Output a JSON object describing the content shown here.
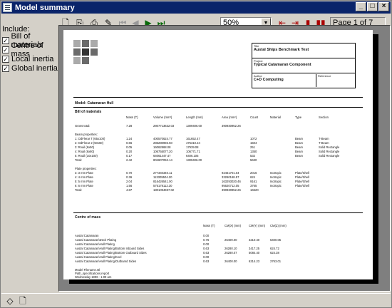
{
  "window": {
    "title": "Model summary"
  },
  "toolbar": {
    "zoom_value": "50%",
    "page_indicator": "Page 1 of 7",
    "icons": [
      "new-page-icon",
      "copy-icon",
      "print-icon",
      "print-setup-icon",
      "first-page-icon",
      "previous-page-icon",
      "next-page-icon",
      "last-page-icon",
      "fit-width-icon",
      "fit-page-icon",
      "one-page-icon",
      "two-page-icon"
    ]
  },
  "sidebar": {
    "include_label": "Include:",
    "options": [
      {
        "label": "Bill of materials",
        "checked": true
      },
      {
        "label": "Centre of mass",
        "checked": true
      },
      {
        "label": "Local inertia",
        "checked": true
      },
      {
        "label": "Global inertia",
        "checked": true
      }
    ]
  },
  "report": {
    "header": {
      "title_label": "Title",
      "title": "Austal Ships Benchmark Test",
      "project_label": "Project",
      "project": "Typical Catamaran Component",
      "author_label": "Author",
      "author": "C+D Computing",
      "reference_label": "Reference"
    },
    "model_line": "Model: Catamaran Hull",
    "bom_heading": "Bill of materials",
    "bom_columns": [
      "Mass (T)",
      "Volume (mm³)",
      "Length (mm)",
      "Area (mm²)",
      "Count",
      "Material",
      "Type",
      "Section"
    ],
    "bom_gross": [
      "Gross total:",
      "7.28",
      "2807713632.03",
      "1309406.00",
      "390930952.26",
      "",
      "",
      "",
      ""
    ],
    "beam_label": "Beam properties:",
    "beam_rows": [
      [
        "1: OdFlerar T (65x100)",
        "1.24",
        "400570624.77",
        "161652.47",
        "",
        "1072",
        "",
        "Beam",
        "T-Beam"
      ],
      [
        "2: OdFlerar 2 (50x60)",
        "0.66",
        "286280993.50",
        "475310.24",
        "",
        "1504",
        "",
        "Beam",
        "T-Beam"
      ],
      [
        "3: Rnail (6x50)",
        "0.05",
        "16062868.08",
        "17939.08",
        "",
        "251",
        "",
        "Beam",
        "Solid Rectangle"
      ],
      [
        "4: Rnail (6x80)",
        "0.20",
        "106755077.20",
        "106771.71",
        "",
        "1350",
        "",
        "Beam",
        "Solid Rectangle"
      ],
      [
        "5: Rnail (10x100)",
        "0.17",
        "64061447.47",
        "6406.105",
        "",
        "532",
        "",
        "Beam",
        "Solid Rectangle"
      ],
      [
        "Total:",
        "2.42",
        "804607052.14",
        "1309406.00",
        "",
        "5630",
        "",
        "",
        ""
      ]
    ],
    "plate_label": "Plate properties:",
    "plate_rows": [
      [
        "3: 3 mm Plate",
        "0.70",
        "277340340.11",
        "",
        "92461701.04",
        "2016",
        "Isotropic",
        "Plate/Shell",
        ""
      ],
      [
        "4: 4 mm Plate",
        "0.36",
        "113305504.20",
        "",
        "33260168.57",
        "624",
        "Isotropic",
        "Plate/Shell",
        ""
      ],
      [
        "5: 5 mm Plate",
        "2.04",
        "816426541.00",
        "",
        "163293020.46",
        "9161",
        "Isotropic",
        "Plate/Shell",
        ""
      ],
      [
        "6: 6 mm Plate",
        "1.56",
        "575178112.30",
        "",
        "95620712.05",
        "3765",
        "Isotropic",
        "Plate/Shell",
        ""
      ],
      [
        "Total:",
        "4.87",
        "1801094697.02",
        "",
        "390930952.26",
        "16620",
        "",
        "",
        ""
      ]
    ],
    "com_heading": "Centre of mass",
    "com_columns": [
      "Mass (T)",
      "CM(X) (mm)",
      "CM(Y) (mm)",
      "CM(Z) (mm)"
    ],
    "com_rows": [
      [
        "Austal Catamaran",
        "0.00",
        "",
        "",
        ""
      ],
      [
        "Austal Catamaran\\Deck Plating",
        "0.76",
        "26400.00",
        "3210.40",
        "5400.05"
      ],
      [
        "Austal Catamaran\\Hull Plating",
        "0.00",
        "",
        "",
        ""
      ],
      [
        "Austal Catamaran\\Hull Plating\\Bottom Inboard Sides",
        "0.63",
        "26280.10",
        "3417.25",
        "624.72"
      ],
      [
        "Austal Catamaran\\Hull Plating\\Bottom Outboard Sides",
        "0.63",
        "26280.07",
        "5084.40",
        "624.38"
      ],
      [
        "Austal Catamaran\\Hull Plating\\Keel",
        "0.00",
        "",
        "",
        ""
      ],
      [
        "Austal Catamaran\\Hull Plating\\Outboard Sides",
        "0.63",
        "26400.00",
        "6314.23",
        "2763.01"
      ]
    ],
    "footer_lines": [
      "Model Filename.stl",
      "Path_specifications.report",
      "Wednesday 1996 - 1:09 am"
    ]
  },
  "statusbar": {
    "icons": [
      "layer-icon",
      "page-icon"
    ]
  }
}
